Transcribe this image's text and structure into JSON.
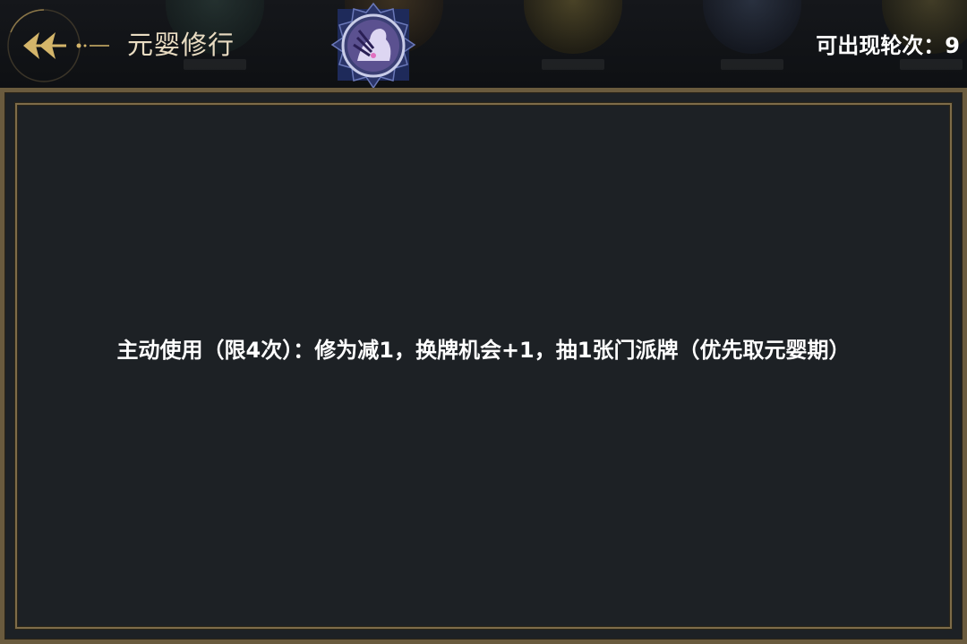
{
  "header": {
    "title": "元婴修行",
    "back_icon": "back-arrow-icon",
    "emblem_icon": "skill-emblem-icon",
    "rounds_label": "可出现轮次：",
    "rounds_value": "9"
  },
  "panel": {
    "description": "主动使用（限4次）：修为减1，换牌机会+1，抽1张门派牌（优先取元婴期）"
  },
  "colors": {
    "gold": "#d4b56a",
    "panel_bg": "#1d2125",
    "frame": "#7e6c49",
    "title_text": "#e9dcc2"
  }
}
